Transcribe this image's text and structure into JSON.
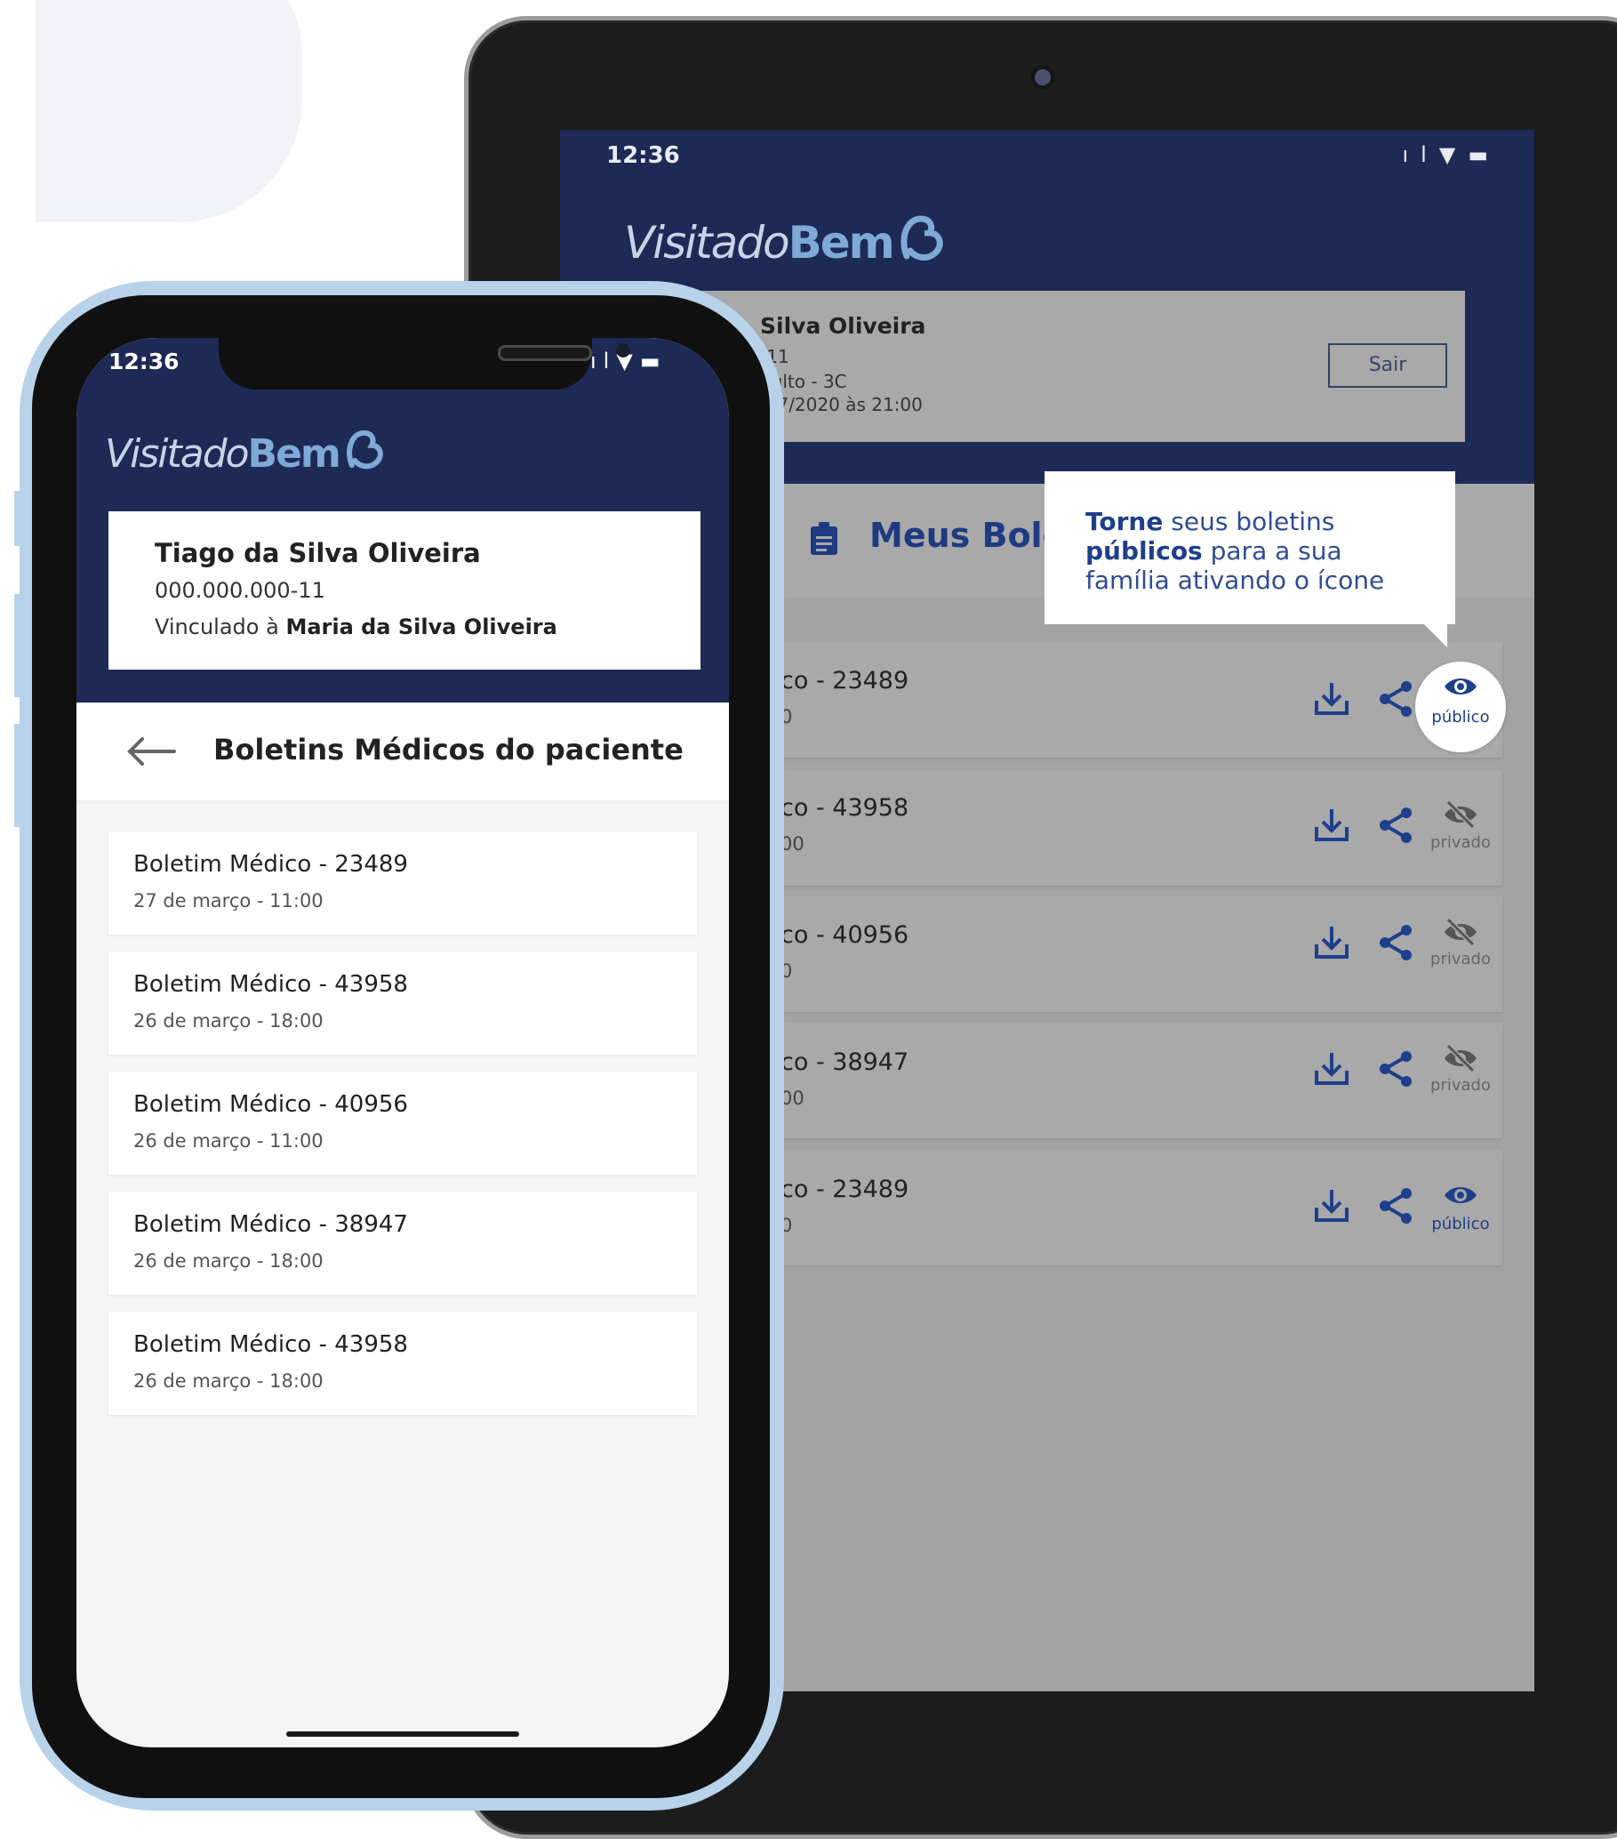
{
  "brand": {
    "visita": "Visita",
    "do": "do",
    "bem": "Bem"
  },
  "tablet": {
    "time": "12:36",
    "user": {
      "name": "Silva Oliveira",
      "line1": "-11",
      "line2": "dulto - 3C",
      "line3": "/07/2020 às 21:00"
    },
    "logout_label": "Sair",
    "section_title": "Meus Bole",
    "tooltip": {
      "b1": "Torne",
      "t1": " seus boletins ",
      "b2": "públicos",
      "t2": " para a sua família ativando o ícone"
    },
    "rows": [
      {
        "title": "co - 23489",
        "sub": "0",
        "visibility": "público"
      },
      {
        "title": "co - 43958",
        "sub": "00",
        "visibility": "privado"
      },
      {
        "title": "co - 40956",
        "sub": "0",
        "visibility": "privado"
      },
      {
        "title": "co - 38947",
        "sub": "00",
        "visibility": "privado"
      },
      {
        "title": "co - 23489",
        "sub": "0",
        "visibility": "público"
      }
    ]
  },
  "phone": {
    "time": "12:36",
    "patient": {
      "name": "Tiago da Silva Oliveira",
      "cpf": "000.000.000-11",
      "linked_prefix": "Vinculado à ",
      "linked_name": "Maria da Silva Oliveira"
    },
    "page_title": "Boletins Médicos do paciente",
    "items": [
      {
        "title": "Boletim Médico - 23489",
        "date": "27 de março - 11:00"
      },
      {
        "title": "Boletim Médico - 43958",
        "date": "26 de março - 18:00"
      },
      {
        "title": "Boletim Médico - 40956",
        "date": "26 de março - 11:00"
      },
      {
        "title": "Boletim Médico - 38947",
        "date": "26 de março - 18:00"
      },
      {
        "title": "Boletim Médico - 43958",
        "date": "26 de março - 18:00"
      }
    ]
  },
  "colors": {
    "navy": "#1d2a55",
    "accent_blue": "#1e3f8b",
    "light_blue_logo": "#7fa9d6",
    "phone_frame": "#b8d2ea"
  },
  "icons": [
    "signal-icon",
    "wifi-icon",
    "battery-icon",
    "clipboard-icon",
    "download-icon",
    "share-icon",
    "eye-icon",
    "eye-off-icon",
    "back-arrow-icon",
    "logo-b-icon"
  ]
}
